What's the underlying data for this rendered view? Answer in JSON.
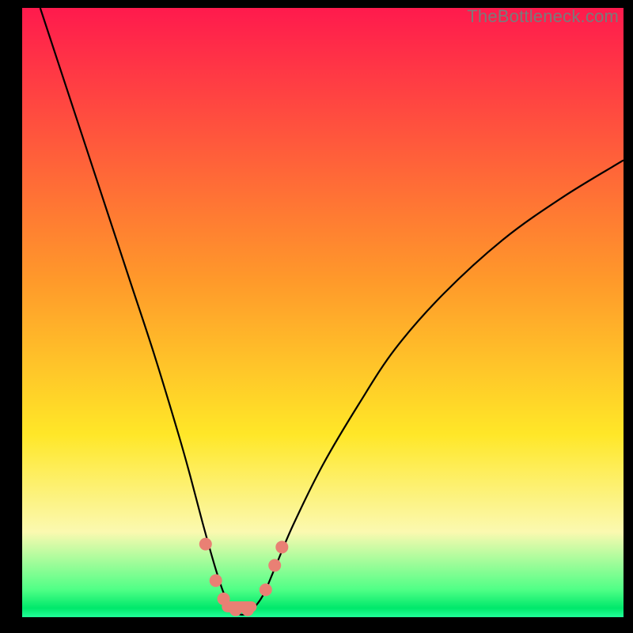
{
  "watermark": "TheBottleneck.com",
  "chart_data": {
    "type": "line",
    "title": "",
    "xlabel": "",
    "ylabel": "",
    "xlim": [
      0,
      100
    ],
    "ylim": [
      0,
      100
    ],
    "background_gradient": {
      "stops": [
        {
          "offset": 0.0,
          "color": "#ff1a4d"
        },
        {
          "offset": 0.45,
          "color": "#ff9a2a"
        },
        {
          "offset": 0.7,
          "color": "#ffe728"
        },
        {
          "offset": 0.86,
          "color": "#fbf9b0"
        },
        {
          "offset": 0.955,
          "color": "#4fff86"
        },
        {
          "offset": 0.985,
          "color": "#00e86b"
        },
        {
          "offset": 1.0,
          "color": "#22ff99"
        }
      ]
    },
    "series": [
      {
        "name": "bottleneck-curve",
        "color": "#000000",
        "x": [
          3.0,
          6.0,
          10.0,
          14.0,
          18.0,
          22.0,
          26.0,
          28.0,
          30.0,
          32.0,
          33.5,
          35.0,
          36.5,
          38.0,
          40.0,
          42.0,
          45.0,
          50.0,
          56.0,
          62.0,
          70.0,
          80.0,
          90.0,
          100.0
        ],
        "y": [
          100.0,
          91.0,
          79.0,
          67.0,
          55.0,
          43.0,
          30.0,
          23.0,
          15.5,
          8.5,
          4.0,
          1.2,
          0.4,
          1.0,
          3.5,
          8.0,
          15.0,
          25.0,
          35.0,
          44.0,
          53.0,
          62.0,
          69.0,
          75.0
        ]
      }
    ],
    "markers": {
      "name": "highlight-points",
      "color": "#e98074",
      "radius_px": 8,
      "points": [
        {
          "x": 30.5,
          "y": 12.0
        },
        {
          "x": 32.2,
          "y": 6.0
        },
        {
          "x": 33.5,
          "y": 3.0
        },
        {
          "x": 35.5,
          "y": 1.2
        },
        {
          "x": 37.5,
          "y": 1.2
        },
        {
          "x": 40.5,
          "y": 4.5
        },
        {
          "x": 42.0,
          "y": 8.5
        },
        {
          "x": 43.2,
          "y": 11.5
        }
      ]
    },
    "accent_band": {
      "color": "#e98074",
      "y": 0.8,
      "x_start": 33.2,
      "x_end": 39.0,
      "height": 1.8
    }
  }
}
